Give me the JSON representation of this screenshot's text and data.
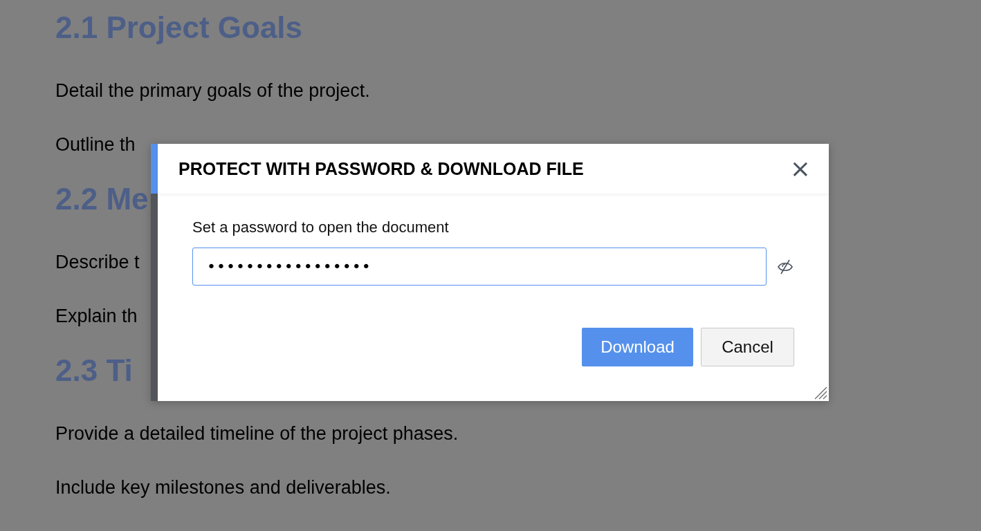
{
  "document": [
    {
      "kind": "heading",
      "text": "2.1 Project Goals"
    },
    {
      "kind": "paragraph",
      "text": "Detail the primary goals of the project."
    },
    {
      "kind": "paragraph",
      "text": "Outline th"
    },
    {
      "kind": "heading",
      "text": "2.2 Me"
    },
    {
      "kind": "paragraph",
      "text": "Describe t"
    },
    {
      "kind": "paragraph",
      "text": "Explain th"
    },
    {
      "kind": "heading",
      "text": "2.3 Ti"
    },
    {
      "kind": "paragraph",
      "text": "Provide a detailed timeline of the project phases."
    },
    {
      "kind": "paragraph",
      "text": "Include key milestones and deliverables."
    }
  ],
  "dialog": {
    "title": "PROTECT WITH PASSWORD & DOWNLOAD FILE",
    "close": "×",
    "label": "Set a password to open the document",
    "password": "•••••••••••••••••",
    "focused": true,
    "buttons": [
      {
        "label": "Download",
        "kind": "primary"
      },
      {
        "label": "Cancel",
        "kind": "secondary"
      }
    ]
  }
}
